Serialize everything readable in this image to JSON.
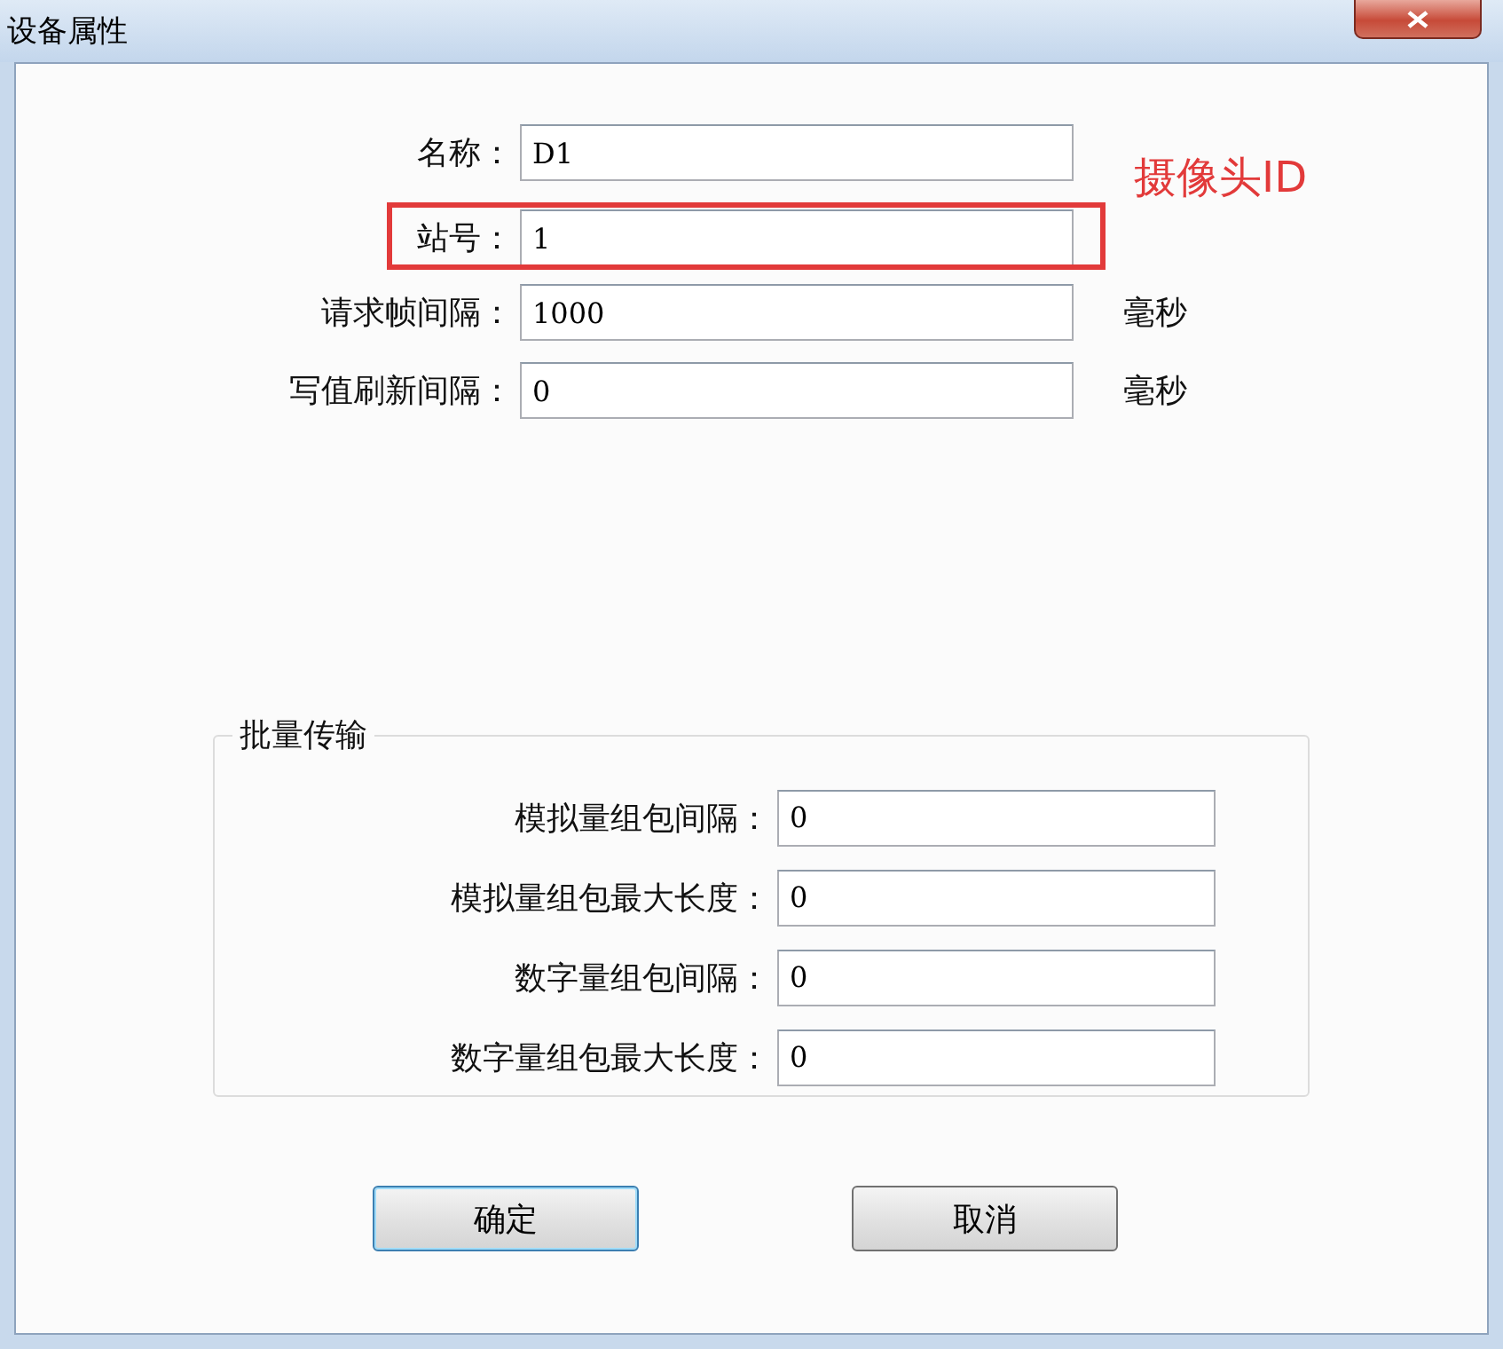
{
  "window": {
    "title": "设备属性"
  },
  "fields": [
    {
      "label": "名称：",
      "value": "D1",
      "highlighted": false
    },
    {
      "label": "站号：",
      "value": "1",
      "highlighted": true
    },
    {
      "label": "请求帧间隔：",
      "value": "1000",
      "unit": "毫秒",
      "highlighted": false
    },
    {
      "label": "写值刷新间隔：",
      "value": "0",
      "unit": "毫秒",
      "highlighted": false
    }
  ],
  "annotation": "摄像头ID",
  "batch": {
    "title": "批量传输",
    "fields": [
      {
        "label": "模拟量组包间隔：",
        "value": "0"
      },
      {
        "label": "模拟量组包最大长度：",
        "value": "0"
      },
      {
        "label": "数字量组包间隔：",
        "value": "0"
      },
      {
        "label": "数字量组包最大长度：",
        "value": "0"
      }
    ]
  },
  "buttons": [
    {
      "label": "确定",
      "default": true
    },
    {
      "label": "取消",
      "default": false
    }
  ]
}
